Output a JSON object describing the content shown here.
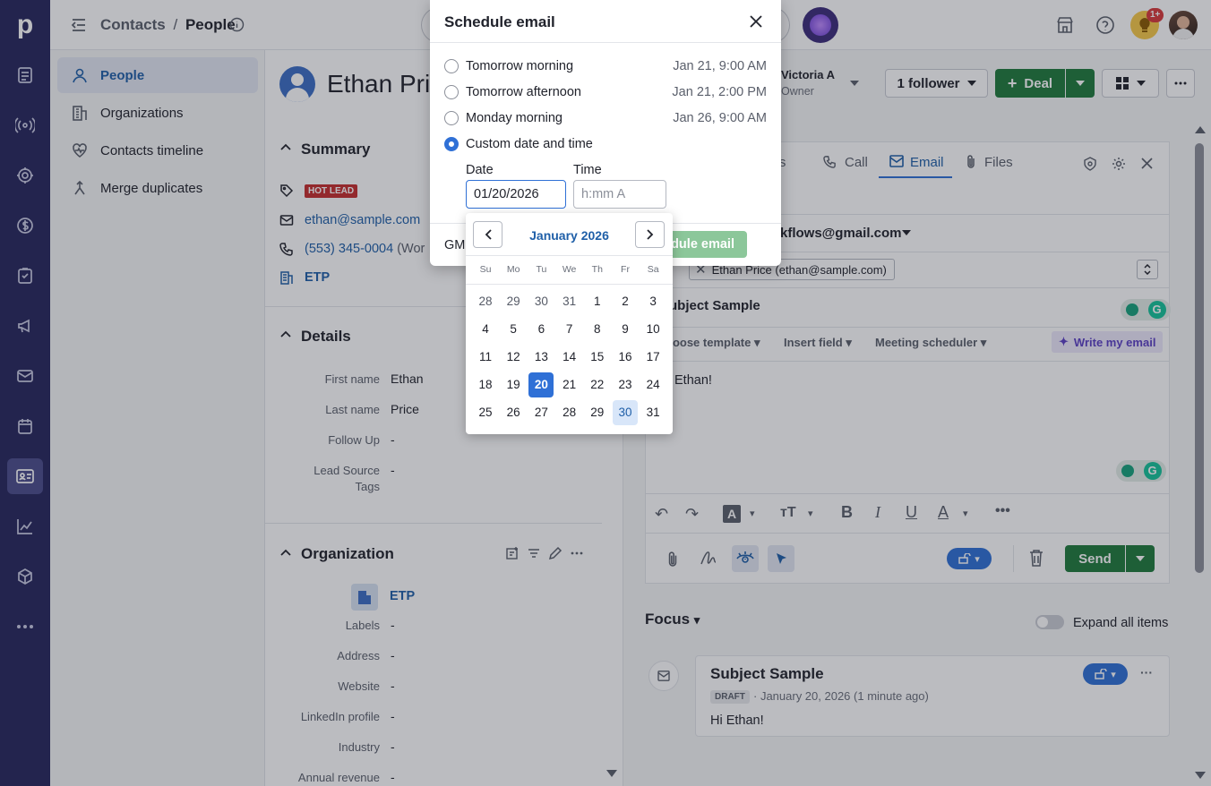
{
  "rail": {
    "logo": "p",
    "icons": [
      "leads-icon",
      "activity-radar-icon",
      "target-icon",
      "dollar-icon",
      "task-icon",
      "megaphone-icon",
      "mail-icon",
      "calendar-icon",
      "contacts-card-icon",
      "chart-icon",
      "box-icon",
      "more-icon"
    ]
  },
  "header": {
    "breadcrumb_root": "Contacts",
    "breadcrumb_sep": "/",
    "breadcrumb_current": "People",
    "notification_badge": "1+"
  },
  "sidebar": {
    "items": [
      {
        "label": "People",
        "icon": "person-icon"
      },
      {
        "label": "Organizations",
        "icon": "building-icon"
      },
      {
        "label": "Contacts timeline",
        "icon": "heart-pulse-icon"
      },
      {
        "label": "Merge duplicates",
        "icon": "merge-icon"
      }
    ]
  },
  "person": {
    "name": "Ethan Price",
    "owner_name": "Victoria A",
    "owner_role": "Owner",
    "follower_btn": "1 follower",
    "deal_btn": "Deal"
  },
  "summary": {
    "title": "Summary",
    "tag": "HOT LEAD",
    "email": "ethan@sample.com",
    "phone": "(553) 345-0004",
    "phone_suffix": "(Wor",
    "org": "ETP"
  },
  "details": {
    "title": "Details",
    "fields": [
      {
        "label": "First name",
        "value": "Ethan"
      },
      {
        "label": "Last name",
        "value": "Price"
      },
      {
        "label": "Follow Up",
        "value": "-"
      },
      {
        "label": "Lead Source",
        "label2": "Tags",
        "value": "-"
      }
    ]
  },
  "organization": {
    "title": "Organization",
    "name": "ETP",
    "fields": [
      {
        "label": "Labels",
        "value": "-"
      },
      {
        "label": "Address",
        "value": "-"
      },
      {
        "label": "Website",
        "value": "-"
      },
      {
        "label": "LinkedIn profile",
        "value": "-"
      },
      {
        "label": "Industry",
        "value": "-"
      },
      {
        "label": "Annual revenue",
        "value": "-"
      }
    ]
  },
  "composer": {
    "tabs": [
      "otes",
      "Call",
      "Email",
      "Files"
    ],
    "from": "kflows@gmail.com",
    "to_chip": "Ethan Price (ethan@sample.com)",
    "subject": "Subject Sample",
    "toolbar": [
      "hoose template",
      "Insert field",
      "Meeting scheduler"
    ],
    "ai_btn": "Write my email",
    "body": "Ethan!",
    "send_btn": "Send"
  },
  "focus": {
    "title": "Focus",
    "toggle_label": "Expand all items",
    "card_title": "Subject Sample",
    "card_badge": "DRAFT",
    "card_meta": "· January 20, 2026 (1 minute ago)",
    "card_body": "Hi Ethan!"
  },
  "dialog": {
    "title": "Schedule email",
    "options": [
      {
        "label": "Tomorrow morning",
        "when": "Jan 21, 9:00 AM"
      },
      {
        "label": "Tomorrow afternoon",
        "when": "Jan 21, 2:00 PM"
      },
      {
        "label": "Monday morning",
        "when": "Jan 26, 9:00 AM"
      },
      {
        "label": "Custom date and time",
        "when": ""
      }
    ],
    "date_label": "Date",
    "date_value": "01/20/2026",
    "time_label": "Time",
    "time_placeholder": "h:mm A",
    "tz_text": "GM",
    "schedule_btn": "dule email"
  },
  "calendar": {
    "month": "January 2026",
    "weekdays": [
      "Su",
      "Mo",
      "Tu",
      "We",
      "Th",
      "Fr",
      "Sa"
    ],
    "weeks": [
      [
        "28",
        "29",
        "30",
        "31",
        "1",
        "2",
        "3"
      ],
      [
        "4",
        "5",
        "6",
        "7",
        "8",
        "9",
        "10"
      ],
      [
        "11",
        "12",
        "13",
        "14",
        "15",
        "16",
        "17"
      ],
      [
        "18",
        "19",
        "20",
        "21",
        "22",
        "23",
        "24"
      ],
      [
        "25",
        "26",
        "27",
        "28",
        "29",
        "30",
        "31"
      ]
    ],
    "selected": "20",
    "highlighted": "30"
  },
  "colors": {
    "rail": "#26265c",
    "accent": "#2f70d6",
    "green": "#1f7a3c",
    "hot": "#c62d2d"
  }
}
